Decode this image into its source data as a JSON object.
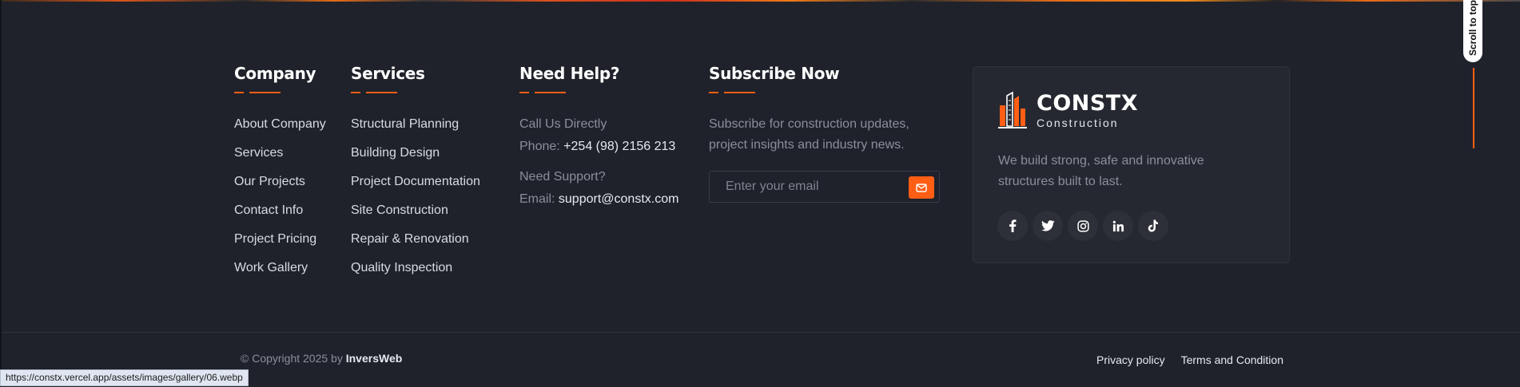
{
  "company": {
    "title": "Company",
    "links": [
      "About Company",
      "Services",
      "Our Projects",
      "Contact Info",
      "Project Pricing",
      "Work Gallery"
    ]
  },
  "services": {
    "title": "Services",
    "links": [
      "Structural Planning",
      "Building Design",
      "Project Documentation",
      "Site Construction",
      "Repair & Renovation",
      "Quality Inspection"
    ]
  },
  "help": {
    "title": "Need Help?",
    "call_label": "Call Us Directly",
    "phone_prefix": "Phone:",
    "phone": "+254 (98) 2156 213",
    "support_label": "Need Support?",
    "email_prefix": "Email:",
    "email": "support@constx.com"
  },
  "subscribe": {
    "title": "Subscribe Now",
    "text": "Subscribe for construction updates, project insights and industry news.",
    "placeholder": "Enter your email",
    "send_icon": "envelope-icon"
  },
  "brand": {
    "name": "CONSTX",
    "sub": "Construction",
    "description": "We build strong, safe and innovative structures built to last.",
    "socials": [
      "facebook-icon",
      "twitter-icon",
      "instagram-icon",
      "linkedin-icon",
      "tiktok-icon"
    ]
  },
  "footer_bottom": {
    "copyright_prefix": "© Copyright 2025 by",
    "company": "InversWeb",
    "links": [
      "Privacy policy",
      "Terms and Condition"
    ]
  },
  "scroll_top": {
    "label": "Scroll to top"
  },
  "status_url": "https://constx.vercel.app/assets/images/gallery/06.webp",
  "colors": {
    "accent": "#ff5e14",
    "background": "#1f222a",
    "card": "#252830"
  }
}
